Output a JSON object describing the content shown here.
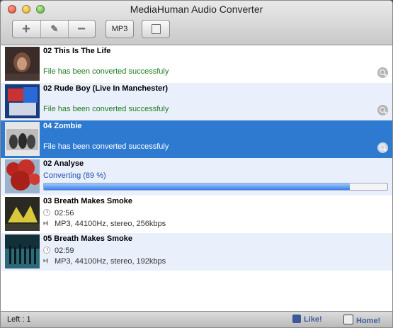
{
  "window": {
    "title": "MediaHuman Audio Converter"
  },
  "toolbar": {
    "add_symbol": "+",
    "clear_symbol": "✎",
    "remove_symbol": "−",
    "format_label": "MP3"
  },
  "tracks": [
    {
      "title": "02 This Is The Life",
      "status": "File has been converted successfuly"
    },
    {
      "title": "02 Rude Boy (Live In Manchester)",
      "status": "File has been converted successfuly"
    },
    {
      "title": "04 Zombie",
      "status": "File has been converted successfuly"
    },
    {
      "title": "02 Analyse",
      "status": "Converting (89 %)",
      "progress": 0.89
    },
    {
      "title": "03 Breath Makes Smoke",
      "duration": "02:56",
      "info": "MP3, 44100Hz, stereo, 256kbps"
    },
    {
      "title": "05 Breath Makes Smoke",
      "duration": "02:59",
      "info": "MP3, 44100Hz, stereo, 192kbps"
    }
  ],
  "statusbar": {
    "left": "Left : 1",
    "like": "Like!",
    "home": "Home!"
  },
  "colors": {
    "selected": "#2f7ad1",
    "success": "#1e7d1e",
    "converting": "#1d4fb3",
    "alt_row": "#eaf0fb"
  }
}
